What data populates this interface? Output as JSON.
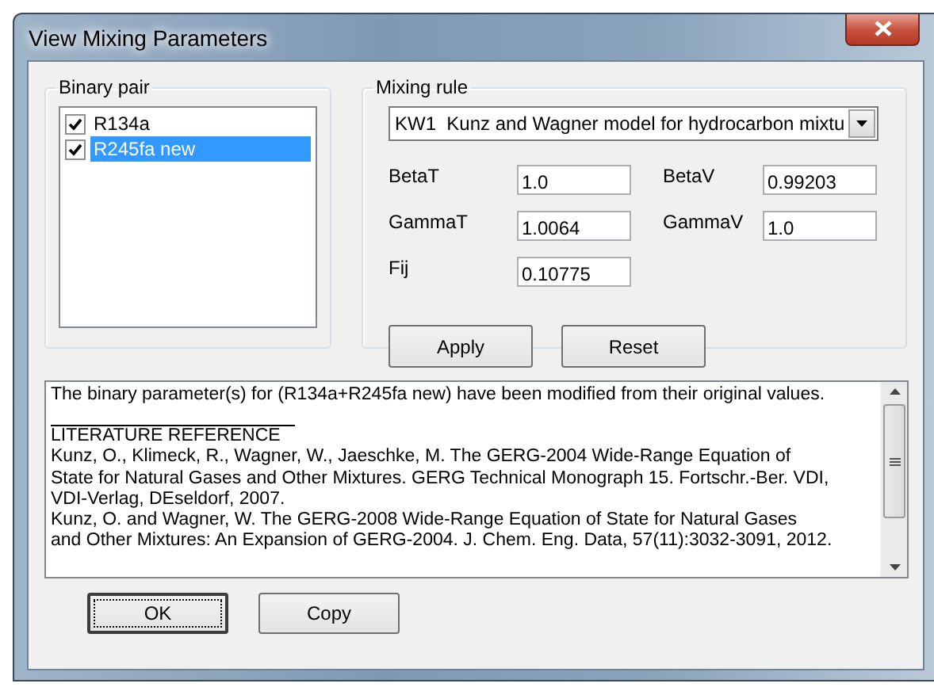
{
  "window": {
    "title": "View Mixing Parameters"
  },
  "binary_pair": {
    "label": "Binary pair",
    "items": [
      {
        "name": "R134a",
        "checked": true,
        "selected": false
      },
      {
        "name": "R245fa new",
        "checked": true,
        "selected": true
      }
    ]
  },
  "mixing_rule": {
    "label": "Mixing rule",
    "value": "KW1  Kunz and Wagner model for hydrocarbon mixtu",
    "parameters": [
      {
        "label": "BetaT",
        "value": "1.0"
      },
      {
        "label": "BetaV",
        "value": "0.99203"
      },
      {
        "label": "GammaT",
        "value": "1.0064"
      },
      {
        "label": "GammaV",
        "value": "1.0"
      },
      {
        "label": "Fij",
        "value": "0.10775"
      }
    ],
    "buttons": [
      "Apply",
      "Reset"
    ]
  },
  "notes": {
    "message": "The binary parameter(s) for (R134a+R245fa new) have been modified from their original values.",
    "heading": "LITERATURE REFERENCE",
    "lines": [
      "Kunz, O., Klimeck, R., Wagner, W., Jaeschke, M. The GERG-2004 Wide-Range Equation of",
      "State for Natural Gases and Other Mixtures. GERG Technical Monograph 15. Fortschr.-Ber. VDI,",
      "VDI-Verlag, DEseldorf, 2007.",
      "Kunz, O. and Wagner, W. The GERG-2008 Wide-Range Equation of State for Natural Gases",
      "and Other Mixtures: An Expansion of GERG-2004. J. Chem. Eng. Data, 57(11):3032-3091, 2012."
    ]
  },
  "buttons": [
    {
      "label": "OK",
      "focused": true
    },
    {
      "label": "Copy",
      "focused": false
    }
  ]
}
